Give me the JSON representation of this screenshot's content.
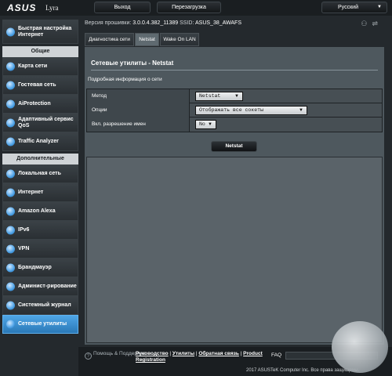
{
  "header": {
    "brand": "ASUS",
    "model": "Lyra",
    "logout": "Выход",
    "reboot": "Перезагрузка",
    "language": "Русский"
  },
  "firmware": {
    "version_label": "Версия прошивки:",
    "version": "3.0.0.4.382_11389",
    "ssid_label": "SSID:",
    "ssid": "ASUS_38_AWAFS"
  },
  "sidebar": {
    "quick_setup": "Быстрая настройка Интернет",
    "general_header": "Общие",
    "general_items": [
      "Карта сети",
      "Гостевая сеть",
      "AiProtection",
      "Адаптивный сервис QoS",
      "Traffic Analyzer"
    ],
    "advanced_header": "Дополнительные настройки",
    "advanced_items": [
      "Локальная сеть",
      "Интернет",
      "Amazon Alexa",
      "IPv6",
      "VPN",
      "Брандмауэр",
      "Админист-рирование",
      "Системный журнал",
      "Сетевые утилиты"
    ]
  },
  "tabs": [
    "Диагностика сети",
    "Netstat",
    "Wake On LAN"
  ],
  "panel": {
    "title": "Сетевые утилиты - Netstat",
    "section": "Подробная информация о сети",
    "rows": [
      {
        "label": "Метод",
        "value": "Netstat"
      },
      {
        "label": "Опции",
        "value": "Отображать все сокеты"
      },
      {
        "label": "Вкл. разрешение имен",
        "value": "No"
      }
    ],
    "button": "Netstat"
  },
  "footer": {
    "help": "Помощь & Поддержка",
    "links": [
      "Руководство",
      "Утилиты",
      "Обратная связь",
      "Product Registration"
    ],
    "faq": "FAQ",
    "copyright": "2017 ASUSTeK Computer Inc. Все права защищены."
  },
  "colors": {
    "active": "#3b8fd4",
    "panel": "#4e585e"
  }
}
